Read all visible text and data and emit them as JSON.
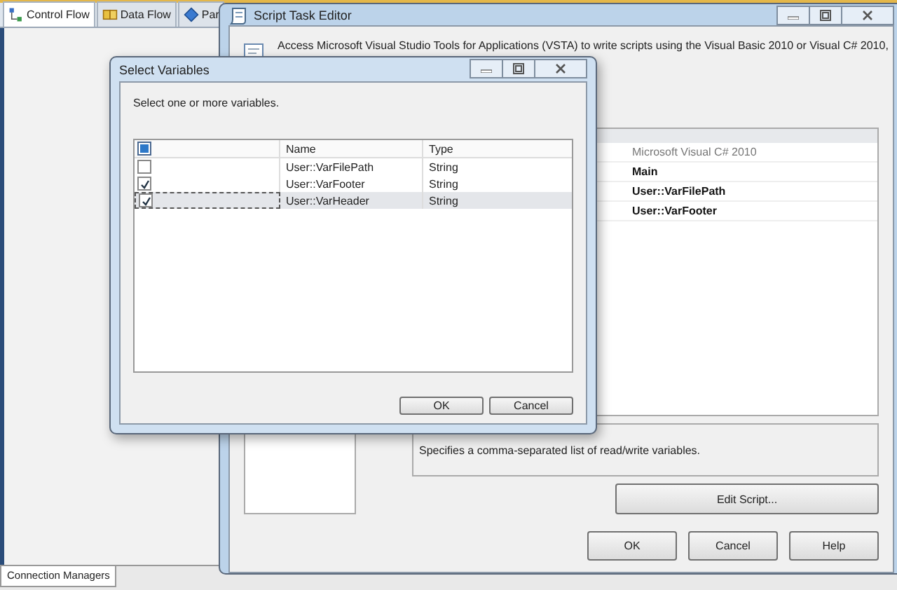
{
  "designer": {
    "tabs": [
      {
        "label": "Control Flow",
        "kind": "control",
        "selected": true
      },
      {
        "label": "Data Flow",
        "kind": "data",
        "selected": false
      },
      {
        "label": "Par",
        "kind": "param",
        "selected": false
      }
    ],
    "bottom_tab": "Connection Managers"
  },
  "script_task_editor": {
    "title": "Script Task Editor",
    "description": "Access Microsoft Visual Studio Tools for Applications (VSTA) to write scripts using the Visual Basic 2010 or Visual C# 2010,",
    "properties": [
      {
        "value": "Microsoft Visual C# 2010",
        "kind": "readonly"
      },
      {
        "value": "Main",
        "kind": "set"
      },
      {
        "value": "User::VarFilePath",
        "kind": "set"
      },
      {
        "value": "User::VarFooter",
        "kind": "set"
      }
    ],
    "property_description": "Specifies a comma-separated list of read/write variables.",
    "edit_button": "Edit Script...",
    "buttons": [
      "OK",
      "Cancel",
      "Help"
    ]
  },
  "select_variables": {
    "title": "Select Variables",
    "prompt": "Select one or more variables.",
    "select_all": {
      "checked": false,
      "mixed": true
    },
    "columns": [
      "Name",
      "Type"
    ],
    "rows": [
      {
        "name": "User::VarFilePath",
        "type": "String",
        "checked": false,
        "selected": false
      },
      {
        "name": "User::VarFooter",
        "type": "String",
        "checked": true,
        "selected": false
      },
      {
        "name": "User::VarHeader",
        "type": "String",
        "checked": true,
        "selected": true
      }
    ],
    "buttons": [
      "OK",
      "Cancel"
    ]
  }
}
